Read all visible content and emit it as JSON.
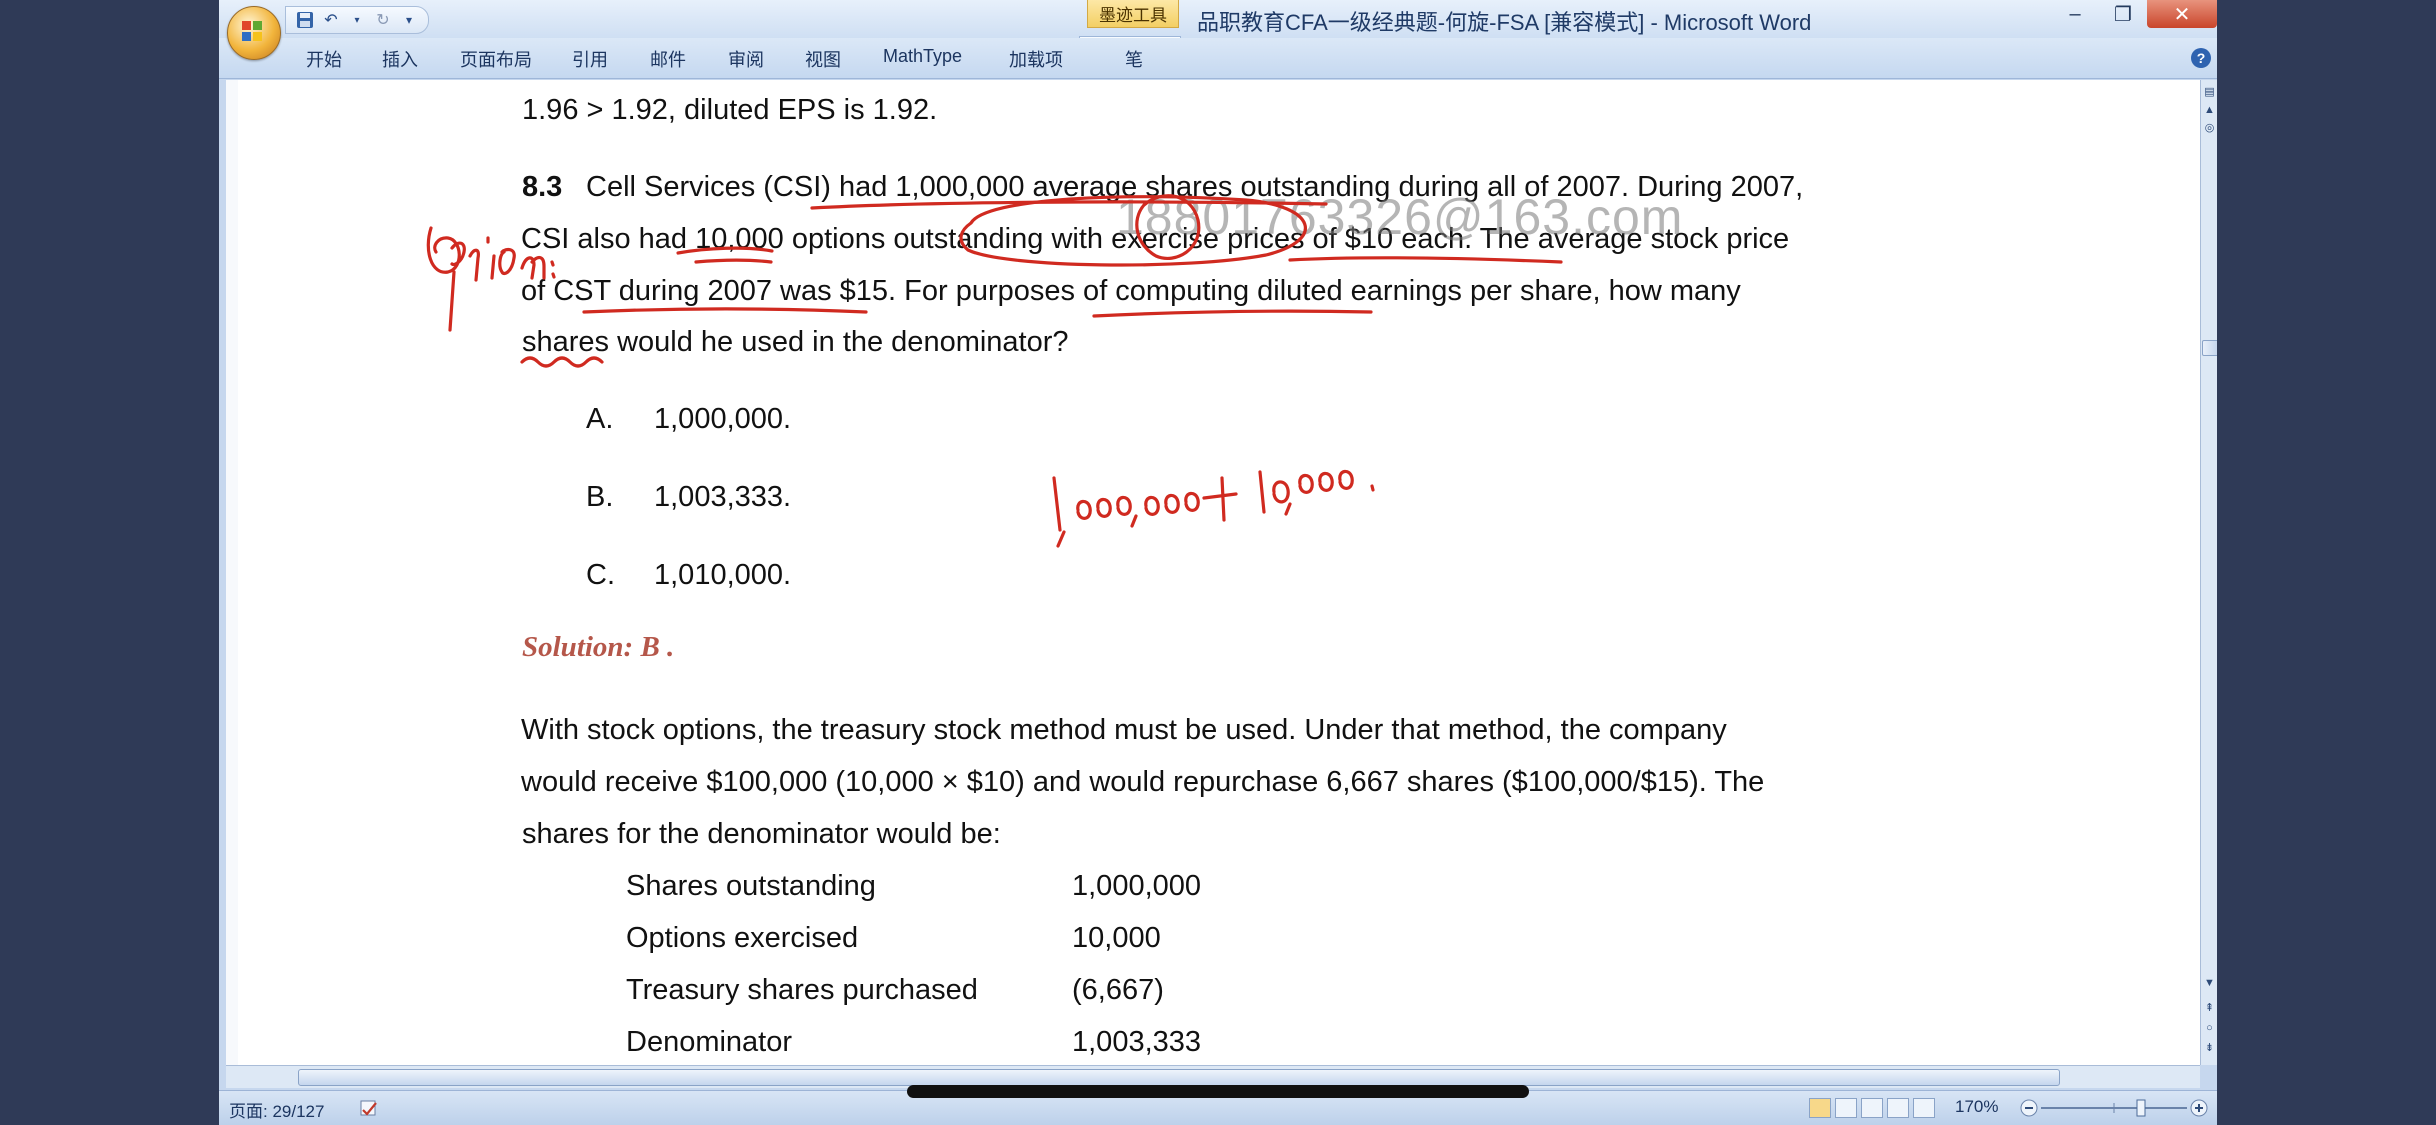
{
  "window": {
    "title": "品职教育CFA一级经典题-何旋-FSA [兼容模式] - Microsoft Word",
    "contextual_tab": "墨迹工具",
    "controls": {
      "minimize": "–",
      "restore": "❐",
      "close": "✕"
    }
  },
  "ribbon": {
    "tabs": [
      "开始",
      "插入",
      "页面布局",
      "引用",
      "邮件",
      "审阅",
      "视图",
      "MathType",
      "加载项",
      "笔"
    ],
    "help": "?"
  },
  "document": {
    "prev_line": "1.96 > 1.92, diluted EPS is 1.92.",
    "question": {
      "number": "8.3",
      "lines": [
        "Cell Services (CSI) had 1,000,000 average shares outstanding during all of 2007. During 2007,",
        "CSI also had 10,000 options outstanding with exercise prices of $10 each. The average stock price",
        "of CST during 2007 was $15. For purposes of computing diluted earnings per share, how many",
        "shares would he used in the denominator?"
      ]
    },
    "choices": [
      {
        "letter": "A.",
        "text": "1,000,000."
      },
      {
        "letter": "B.",
        "text": "1,003,333."
      },
      {
        "letter": "C.",
        "text": "1,010,000."
      }
    ],
    "solution_label": "Solution: B .",
    "explanation_lines": [
      "With stock options, the treasury stock method must be used. Under that method, the company",
      "would receive $100,000 (10,000 × $10) and would repurchase 6,667 shares ($100,000/$15). The",
      "shares for the denominator would be:"
    ],
    "table": [
      {
        "label": "Shares outstanding",
        "value": "1,000,000"
      },
      {
        "label": "Options exercised",
        "value": "10,000"
      },
      {
        "label": "Treasury shares purchased",
        "value": "(6,667)"
      },
      {
        "label": "Denominator",
        "value": "1,003,333"
      }
    ],
    "watermark": "18801763326@163.com",
    "handwriting": {
      "margin_note": "option:",
      "sum_note": "1,000,000 + 10,000 ."
    }
  },
  "status": {
    "page": "页面: 29/127",
    "zoom": "170%"
  },
  "colors": {
    "ink": "#d02a20",
    "solution": "#b5574a",
    "ribbon": "#c5d8f0"
  }
}
